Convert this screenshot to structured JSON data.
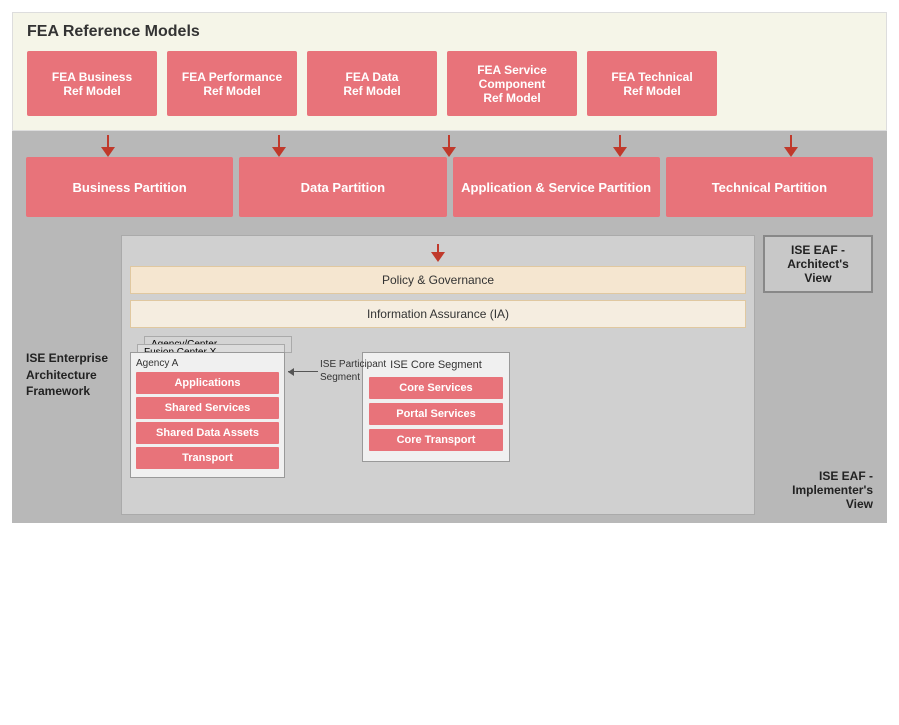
{
  "title": "FEA Reference Models",
  "fea_boxes": [
    {
      "id": "fea-business",
      "label": "FEA Business Ref Model"
    },
    {
      "id": "fea-performance",
      "label": "FEA Performance Ref Model"
    },
    {
      "id": "fea-data",
      "label": "FEA Data Ref Model"
    },
    {
      "id": "fea-service",
      "label": "FEA Service Component Ref Model"
    },
    {
      "id": "fea-technical",
      "label": "FEA Technical Ref Model"
    }
  ],
  "partitions": [
    {
      "id": "business",
      "label": "Business Partition"
    },
    {
      "id": "data",
      "label": "Data Partition"
    },
    {
      "id": "app-service",
      "label": "Application & Service Partition"
    },
    {
      "id": "technical",
      "label": "Technical Partition"
    }
  ],
  "ise_eaf_architect": "ISE EAF - Architect's View",
  "ise_enterprise_label": "ISE Enterprise Architecture Framework",
  "policy_bar": "Policy & Governance",
  "ia_bar": "Information Assurance (IA)",
  "agency_center_label": "Agency/Center ...",
  "fusion_center_label": "Fusion Center X",
  "agency_a_label": "Agency A",
  "participant_segment_label": "ISE Participant Segment",
  "agency_pink_boxes": [
    {
      "id": "applications",
      "label": "Applications"
    },
    {
      "id": "shared-services",
      "label": "Shared Services"
    },
    {
      "id": "shared-data-assets",
      "label": "Shared Data Assets"
    },
    {
      "id": "transport",
      "label": "Transport"
    }
  ],
  "core_segment_label": "ISE Core Segment",
  "core_pink_boxes": [
    {
      "id": "core-services",
      "label": "Core Services"
    },
    {
      "id": "portal-services",
      "label": "Portal Services"
    },
    {
      "id": "core-transport",
      "label": "Core Transport"
    }
  ],
  "ise_eaf_implementer": "ISE EAF - Implementer's View",
  "colors": {
    "pink": "#e8737a",
    "dark_red_arrow": "#c0392b",
    "fea_bg": "#f5f5e8",
    "arch_bg": "#b8b8b8"
  }
}
